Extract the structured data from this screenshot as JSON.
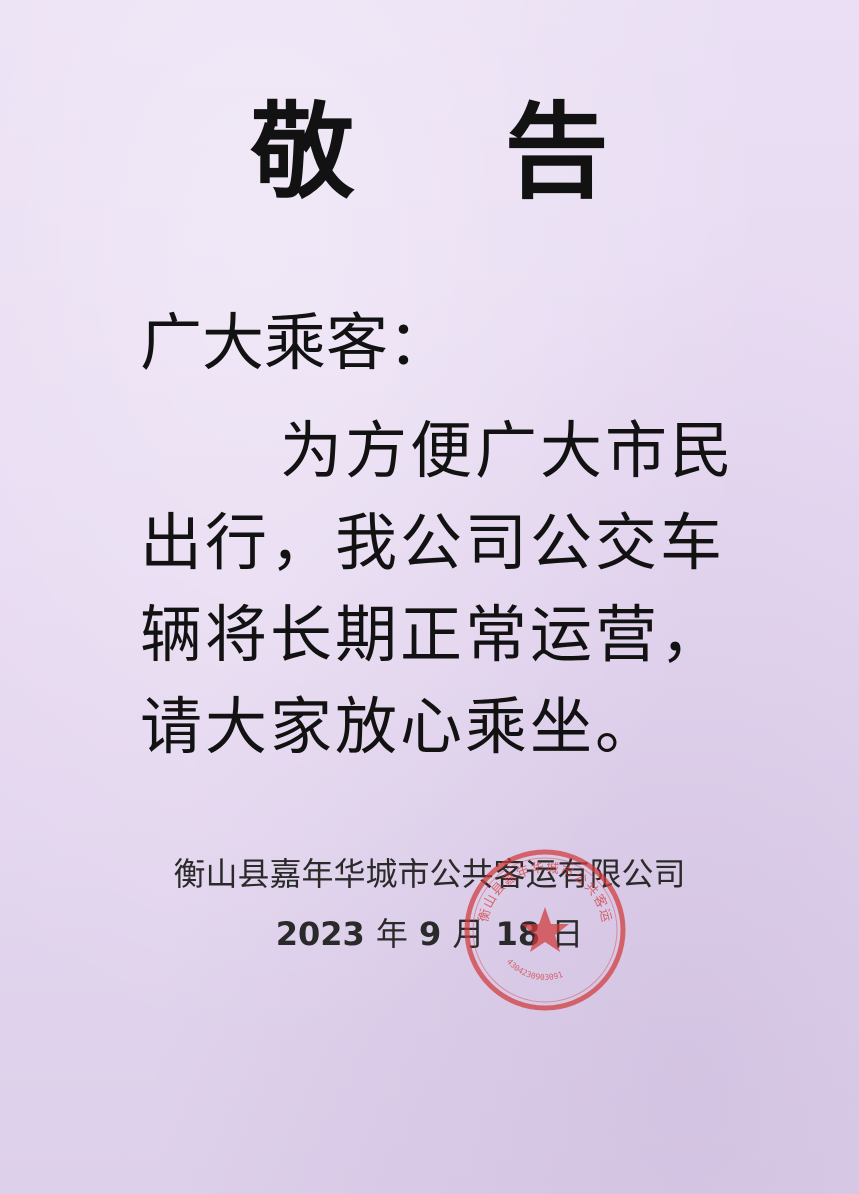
{
  "notice": {
    "title": "敬告",
    "salutation": "广大乘客：",
    "body": "为方便广大市民出行，我公司公交车辆将长期正常运营，请大家放心乘坐。",
    "company": "衡山县嘉年华城市公共客运有限公司",
    "date": {
      "year": "2023",
      "year_unit": "年",
      "month": "9",
      "month_unit": "月",
      "day": "18",
      "day_unit": "日"
    }
  },
  "seal": {
    "color": "#d23a3a",
    "code": "4304230903091"
  }
}
